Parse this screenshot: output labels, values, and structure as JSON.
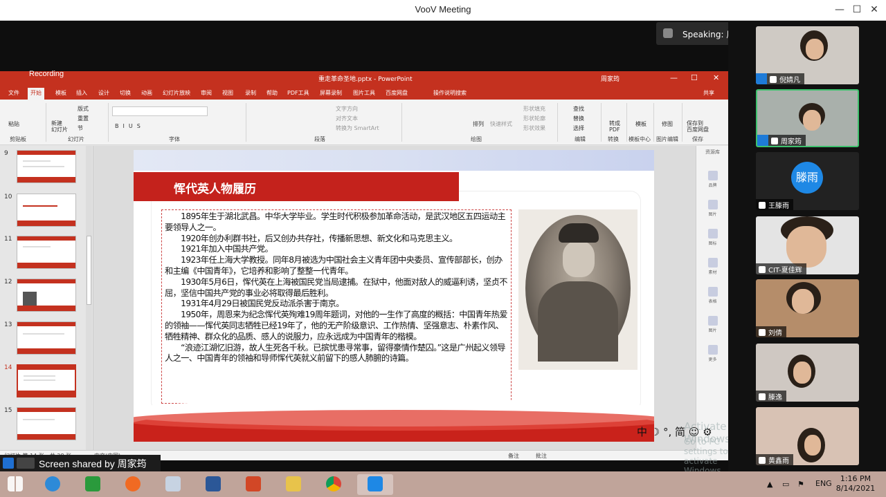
{
  "app": {
    "title": "VooV Meeting"
  },
  "window_controls": {
    "minimize": "—",
    "maximize": "☐",
    "close": "✕",
    "pin": "◫"
  },
  "recording": {
    "label": "Recording"
  },
  "powerpoint": {
    "title": "重走革命圣地.pptx - PowerPoint",
    "user": "周家筠",
    "menu_tabs": [
      "文件",
      "开始",
      "模板",
      "插入",
      "设计",
      "切换",
      "动画",
      "幻灯片放映",
      "审阅",
      "视图",
      "录制",
      "帮助",
      "PDF工具",
      "屏幕录制",
      "图片工具",
      "百度网盘",
      "操作说明搜索"
    ],
    "share": "共享",
    "ribbon_groups": [
      "剪贴板",
      "幻灯片",
      "字体",
      "段落",
      "绘图",
      "编辑",
      "转换",
      "模板中心",
      "图片编辑",
      "保存"
    ],
    "ribbon_buttons": {
      "paste": "粘贴",
      "new_slide": "新建\n幻灯片",
      "layout": "版式",
      "reset": "重置",
      "section": "节",
      "text_direction": "文字方向",
      "align_text": "对齐文本",
      "smartart": "转换为 SmartArt",
      "arrange": "排列",
      "quick_styles": "快速样式",
      "shape_fill": "形状填充",
      "shape_outline": "形状轮廓",
      "shape_effects": "形状效果",
      "find": "查找",
      "replace": "替换",
      "select": "选择",
      "to_pdf": "转成\nPDF",
      "template": "模板",
      "pic_edit": "修图",
      "save_to_cloud": "保存到\n百度网盘"
    },
    "slide_numbers": [
      "9",
      "10",
      "11",
      "12",
      "13",
      "14",
      "15"
    ],
    "selected_slide": "14",
    "status": {
      "slide_info": "幻灯片 第 14 张，共 28 张",
      "language": "中文(中国)",
      "notes": "备注",
      "comments": "批注"
    },
    "right_pane": {
      "title": "资源库",
      "items": [
        "品牌",
        "图片",
        "图标",
        "素材",
        "表格",
        "图片",
        "更多"
      ]
    }
  },
  "slide": {
    "heading": "恽代英人物履历",
    "paragraphs": [
      "　　1895年生于湖北武昌。中华大学毕业。学生时代积极参加革命活动，是武汉地区五四运动主要领导人之一。",
      "　　1920年创办利群书社，后又创办共存社，传播新思想、新文化和马克思主义。",
      "　　1921年加入中国共产党。",
      "　　1923年任上海大学教授。同年8月被选为中国社会主义青年团中央委员、宣传部部长，创办和主编《中国青年》，它培养和影响了整整一代青年。",
      "　　1930年5月6日，恽代英在上海被国民党当局逮捕。在狱中，他面对敌人的威逼利诱，坚贞不屈，坚信中国共产党的事业必将取得最后胜利。",
      "　　1931年4月29日被国民党反动派杀害于南京。",
      "　　1950年，周恩来为纪念恽代英殉难19周年题词，对他的一生作了高度的概括：中国青年热爱的领袖——恽代英同志牺牲已经19年了，他的无产阶级意识、工作热情、坚强意志、朴素作风、牺牲精神、群众化的品质、感人的说服力，应永远成为中国青年的楷模。",
      "　　“浪迹江湖忆旧游，故人生死各千秋。已摈忧患寻常事，留得豪情作楚囚。”这是广州起义领导人之一、中国青年的领袖和导师恽代英就义前留下的感人肺腑的诗篇。"
    ]
  },
  "speaking": {
    "text": "Speaking: 周家筠;"
  },
  "participants": [
    {
      "name": "倪婧凡"
    },
    {
      "name": "周家筠"
    },
    {
      "name": "王滕雨",
      "avatar": "滕雨"
    },
    {
      "name": "CIT-夏佳辉"
    },
    {
      "name": "刘倩"
    },
    {
      "name": "滕逸"
    },
    {
      "name": "黄鑫雨"
    }
  ],
  "screen_share": {
    "label": "Screen shared by 周家筠"
  },
  "ime": {
    "text": "中 ☽ °, 简 ☺ ⚙"
  },
  "watermark": {
    "line1": "Activate Windows",
    "line2": "Go to PC settings to activate Windows."
  },
  "taskbar": {
    "apps": [
      "start",
      "ie",
      "store",
      "firefox",
      "paint",
      "word",
      "powerpoint",
      "explorer",
      "chrome",
      "voov"
    ],
    "lang": "ENG",
    "time": "1:16 PM",
    "date": "8/14/2021"
  },
  "colors": {
    "ppt_red": "#c4311f",
    "active_green": "#3ec16d",
    "host_blue": "#1e7bd8"
  }
}
